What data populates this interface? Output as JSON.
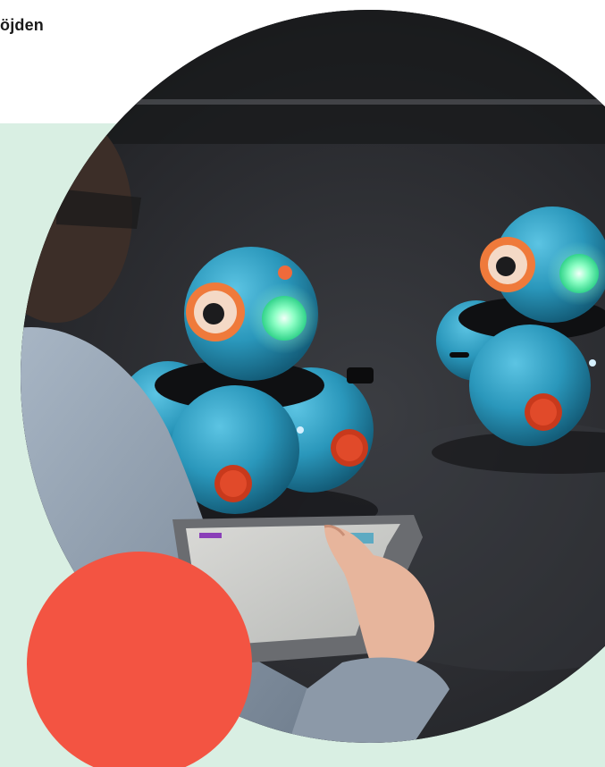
{
  "header": {
    "partial_title": "öjden"
  },
  "hero": {
    "image_icon": "robot-photo-icon"
  },
  "colors": {
    "mint_background": "#d9efe3",
    "accent_coral": "#f35442",
    "robot_blue": "#2f9dc0",
    "robot_eye_ring": "#ef7a3b",
    "robot_glow": "#6fffb3"
  }
}
